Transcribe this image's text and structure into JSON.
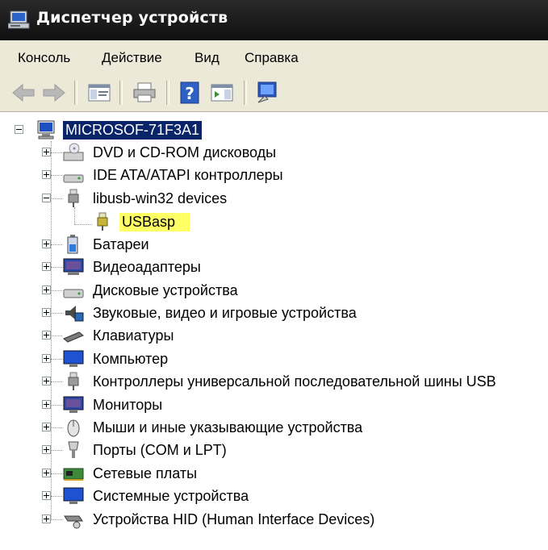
{
  "window": {
    "title": "Диспетчер устройств",
    "icon": "device-manager-icon"
  },
  "menu": [
    "Консоль",
    "Действие",
    "Вид",
    "Справка"
  ],
  "toolbar": {
    "buttons": [
      "back-arrow-icon",
      "forward-arrow-icon",
      "console-tree-icon",
      "print-icon",
      "help-icon",
      "properties-icon",
      "scan-hardware-icon"
    ]
  },
  "tree": {
    "root": {
      "label": "MICROSOF-71F3A1",
      "icon": "computer-icon",
      "expanded": true
    },
    "items": [
      {
        "label": "DVD и CD-ROM дисководы",
        "icon": "cdrom-icon",
        "expanded": false
      },
      {
        "label": "IDE ATA/ATAPI контроллеры",
        "icon": "ide-controller-icon",
        "expanded": false
      },
      {
        "label": "libusb-win32 devices",
        "icon": "usb-plug-icon",
        "expanded": true,
        "children": [
          {
            "label": "USBasp",
            "icon": "usb-plug-yellow-icon",
            "highlight": "#ffff66"
          }
        ]
      },
      {
        "label": "Батареи",
        "icon": "battery-icon",
        "expanded": false
      },
      {
        "label": "Видеоадаптеры",
        "icon": "display-adapter-icon",
        "expanded": false
      },
      {
        "label": "Дисковые устройства",
        "icon": "disk-drive-icon",
        "expanded": false
      },
      {
        "label": "Звуковые, видео и игровые устройства",
        "icon": "sound-icon",
        "expanded": false
      },
      {
        "label": "Клавиатуры",
        "icon": "keyboard-icon",
        "expanded": false
      },
      {
        "label": "Компьютер",
        "icon": "monitor-icon",
        "expanded": false
      },
      {
        "label": "Контроллеры универсальной последовательной шины USB",
        "icon": "usb-plug-icon",
        "expanded": false
      },
      {
        "label": "Мониторы",
        "icon": "monitor-icon",
        "expanded": false
      },
      {
        "label": "Мыши и иные указывающие устройства",
        "icon": "mouse-icon",
        "expanded": false
      },
      {
        "label": "Порты (COM и LPT)",
        "icon": "port-icon",
        "expanded": false
      },
      {
        "label": "Сетевые платы",
        "icon": "network-card-icon",
        "expanded": false
      },
      {
        "label": "Системные устройства",
        "icon": "monitor-icon",
        "expanded": false
      },
      {
        "label": "Устройства HID (Human Interface Devices)",
        "icon": "hid-icon",
        "expanded": false
      }
    ]
  },
  "colors": {
    "selection": "#0a246a",
    "highlight": "#ffff66",
    "chrome": "#ece9d8"
  }
}
